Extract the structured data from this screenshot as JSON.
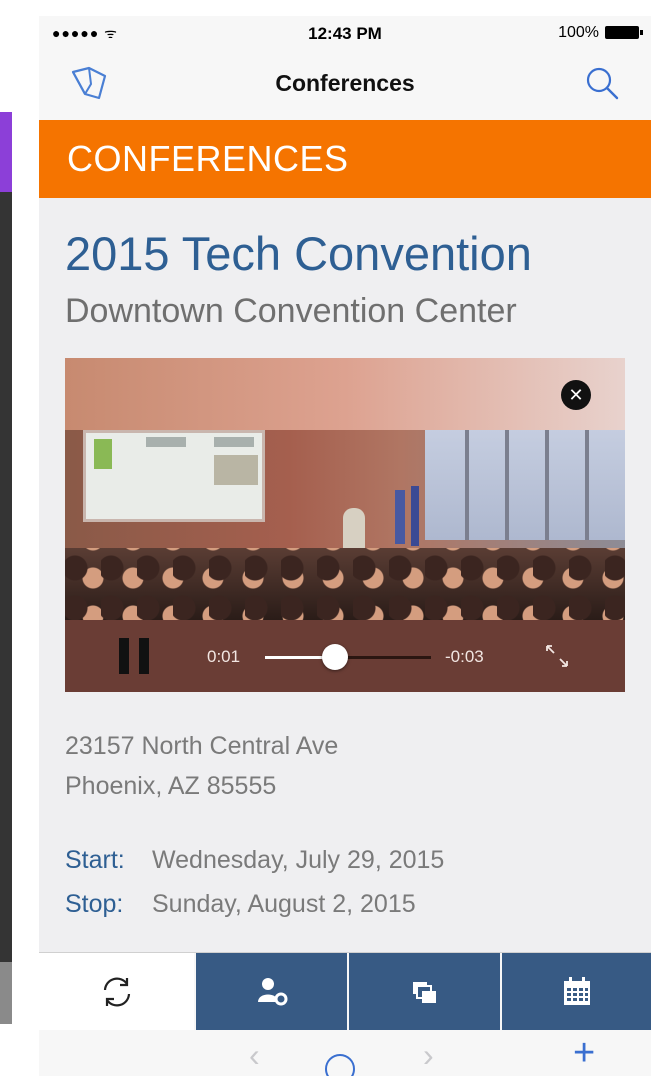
{
  "status_bar": {
    "signal": "●●●●● ᯤ",
    "time": "12:43 PM",
    "battery": "100%"
  },
  "nav": {
    "title": "Conferences",
    "left_icon": "map-icon",
    "right_icon": "search-icon"
  },
  "banner": {
    "label": "CONFERENCES",
    "color": "#f57400"
  },
  "event": {
    "title": "2015 Tech Convention",
    "venue": "Downtown Convention Center",
    "address_line1": "23157 North Central Ave",
    "address_line2": "Phoenix, AZ 85555",
    "start_label": "Start:",
    "start_value": "Wednesday, July 29, 2015",
    "stop_label": "Stop:",
    "stop_value": "Sunday, August 2, 2015"
  },
  "video": {
    "elapsed": "0:01",
    "remaining": "-0:03",
    "progress": 0.42,
    "close_icon": "close-icon",
    "pause_icon": "pause-icon",
    "fullscreen_icon": "fullscreen-icon"
  },
  "tabs": [
    {
      "icon": "refresh-icon",
      "selected": true
    },
    {
      "icon": "user-settings-icon",
      "selected": false
    },
    {
      "icon": "gallery-icon",
      "selected": false
    },
    {
      "icon": "calendar-icon",
      "selected": false
    }
  ],
  "toolbar": {
    "back": "‹",
    "forward": "›",
    "add": "+"
  },
  "colors": {
    "accent": "#2e5f93",
    "tab_dark": "#375a84",
    "ios_blue": "#3a6fd0"
  }
}
